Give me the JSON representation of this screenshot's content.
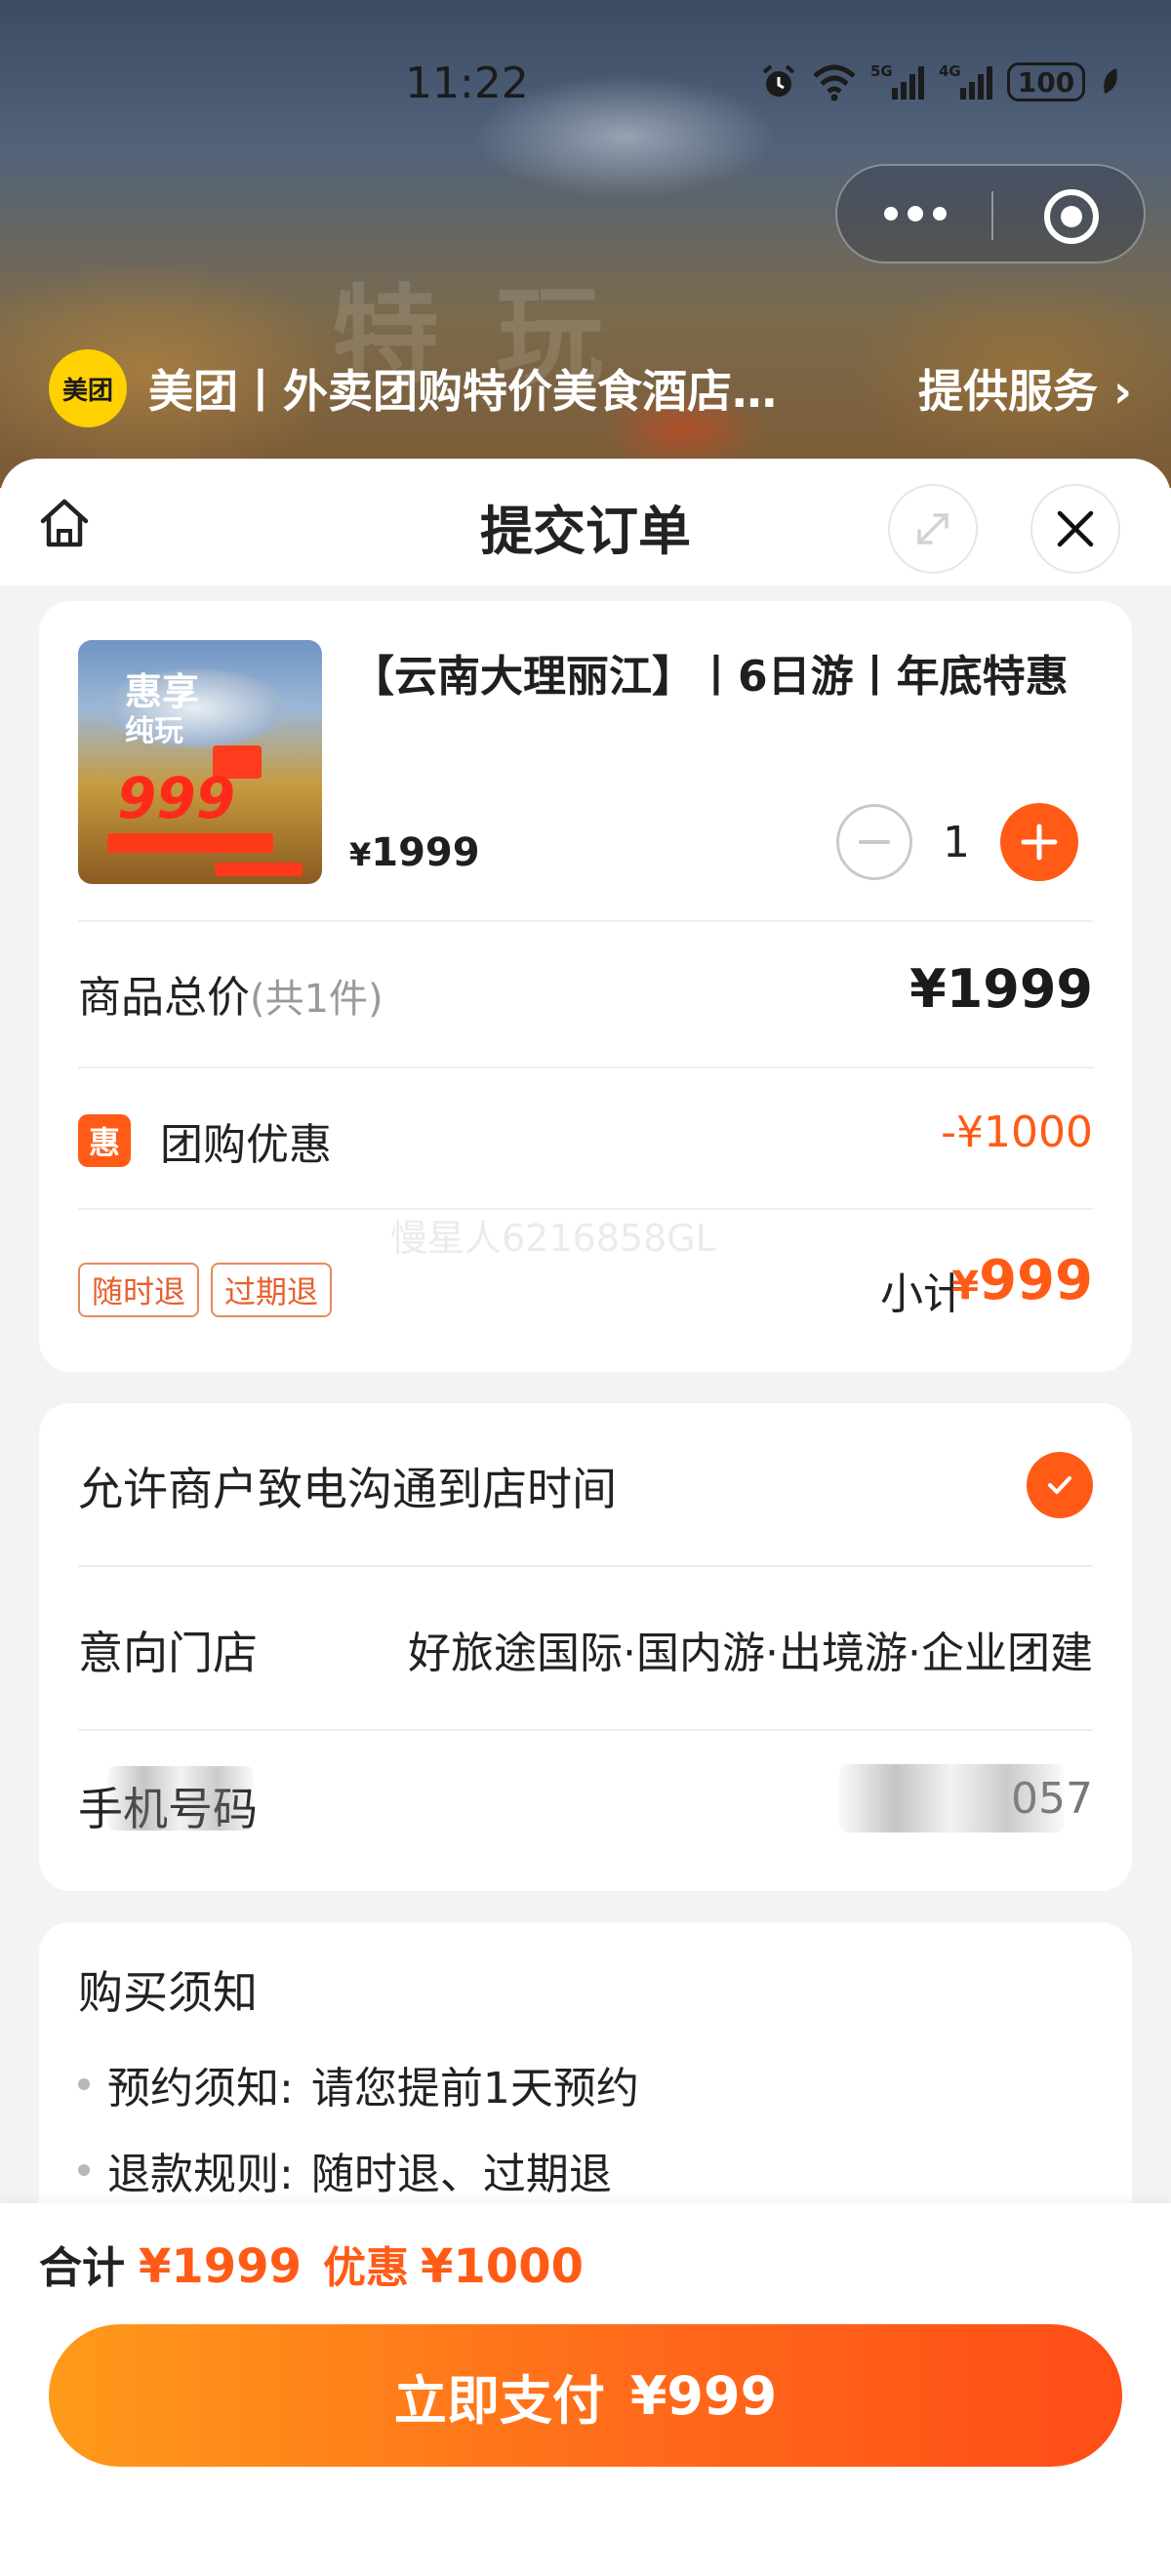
{
  "status_bar": {
    "time": "11:22",
    "signal_5g": "5G",
    "signal_4g": "4G",
    "battery": "100"
  },
  "header": {
    "logo_text": "美团",
    "service_name": "美团丨外卖团购特价美食酒店…",
    "service_link": "提供服务 ›",
    "icons": [
      "more-dots-icon",
      "close-target-icon"
    ]
  },
  "sheet": {
    "title": "提交订单",
    "icons": [
      "home-icon",
      "expand-icon",
      "close-icon"
    ]
  },
  "product": {
    "image_text": {
      "line1": "惠享",
      "line2": "纯玩",
      "price": "999"
    },
    "title": "【云南大理丽江】丨6日游丨年底特惠",
    "price_symbol": "¥",
    "price": "1999",
    "quantity": "1"
  },
  "summary": {
    "total_label": "商品总价",
    "total_count": "(共1件)",
    "total_value": "¥1999",
    "discount_icon": "惠",
    "discount_label": "团购优惠",
    "discount_value": "-¥1000",
    "tags": [
      "随时退",
      "过期退"
    ],
    "subtotal_label": "小计",
    "subtotal_symbol": "¥",
    "subtotal_value": "999",
    "watermark": "慢星人6216858GL"
  },
  "contact": {
    "allow_call_label": "允许商户致电沟通到店时间",
    "allow_call_checked": true,
    "store_label": "意向门店",
    "store_value": "好旅途国际·国内游·出境游·企业团建",
    "phone_label": "手机号码",
    "phone_value": "057"
  },
  "notice": {
    "title": "购买须知",
    "items": [
      {
        "key": "预约须知:",
        "value": "请您提前1天预约"
      },
      {
        "key": "退款规则:",
        "value": "随时退、过期退"
      }
    ]
  },
  "bottom": {
    "sum_label": "合计",
    "sum_value": "¥1999",
    "discount_label": "优惠",
    "discount_value": "¥1000",
    "pay_label": "立即支付",
    "pay_value": "¥999"
  },
  "colors": {
    "accent": "#ff5b16",
    "brand_yellow": "#ffd100"
  }
}
